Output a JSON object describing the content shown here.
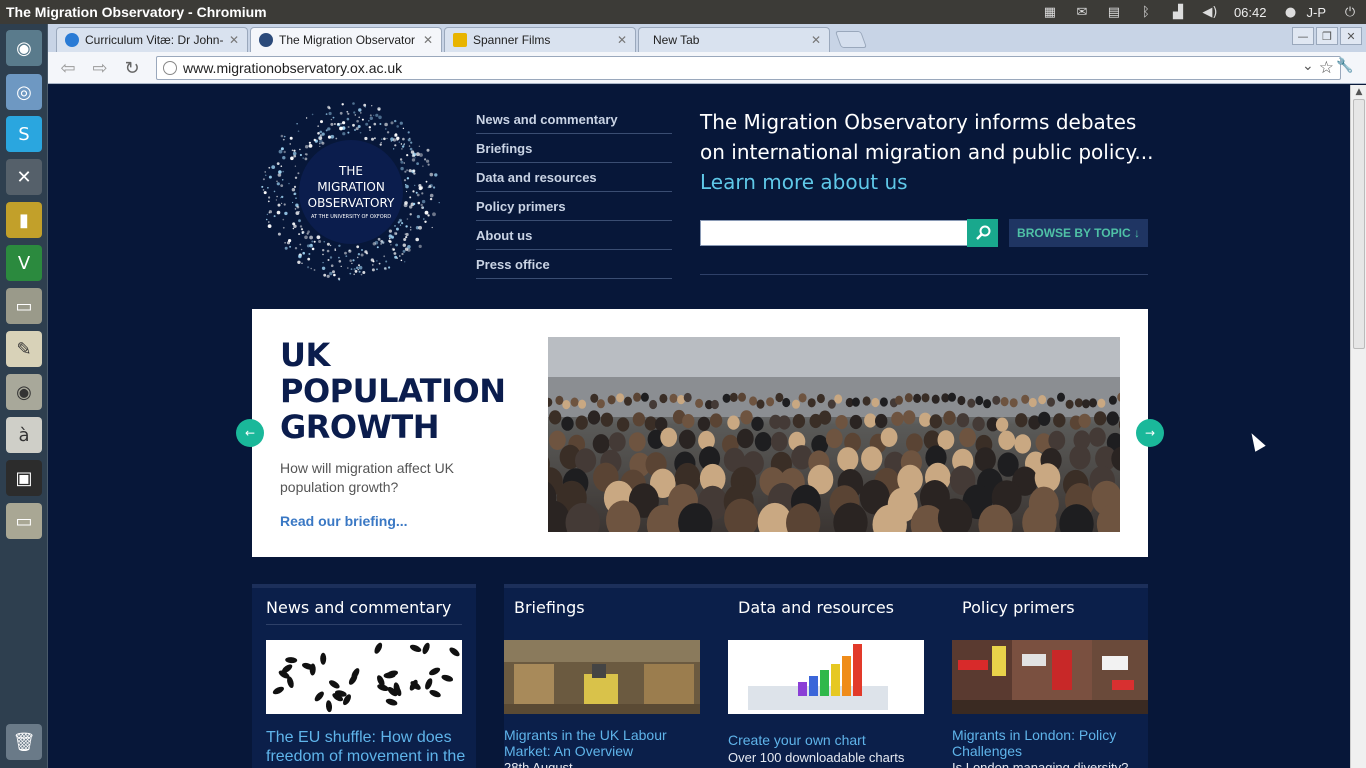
{
  "os": {
    "window_title": "The Migration Observatory - Chromium",
    "clock": "06:42",
    "user": "J-P"
  },
  "browser": {
    "tabs": [
      {
        "label": "Curriculum Vitæ: Dr John-",
        "active": false
      },
      {
        "label": "The Migration Observator",
        "active": true
      },
      {
        "label": "Spanner Films",
        "active": false
      },
      {
        "label": "New Tab",
        "active": false
      }
    ],
    "url": "www.migrationobservatory.ox.ac.uk"
  },
  "site": {
    "logo_lines": [
      "THE",
      "MIGRATION",
      "OBSERVATORY",
      "AT THE UNIVERSITY OF OXFORD"
    ],
    "nav": [
      "News and commentary",
      "Briefings",
      "Data and resources",
      "Policy primers",
      "About us",
      "Press office"
    ],
    "tagline": "The Migration Observatory informs debates on international migration and public policy...",
    "learn_more": "Learn more about us",
    "search_placeholder": "",
    "browse_label": "BROWSE BY TOPIC ↓",
    "hero": {
      "title": "UK POPULATION GROWTH",
      "description": "How will migration affect UK population growth?",
      "link": "Read our briefing..."
    },
    "news": {
      "heading": "News and commentary",
      "link": "The EU shuffle: How does freedom of movement in the"
    },
    "columns": [
      {
        "heading": "Briefings",
        "link": "Migrants in the UK Labour Market: An Overview",
        "sub": "28th August"
      },
      {
        "heading": "Data and resources",
        "link": "Create your own chart",
        "sub": "Over 100 downloadable charts"
      },
      {
        "heading": "Policy primers",
        "link": "Migrants in London: Policy Challenges",
        "sub": "Is London managing diversity?"
      }
    ]
  },
  "colors": {
    "page_bg": "#071739",
    "accent_teal": "#19a88d",
    "link_blue": "#5fb4ea",
    "hero_title": "#0b1d4d"
  }
}
